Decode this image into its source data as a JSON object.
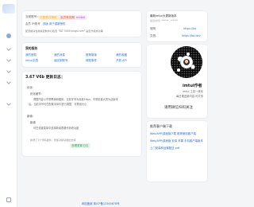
{
  "sidebar": {
    "icons": [
      "logo",
      "home-icon",
      "chevron-icon",
      "chevron-icon",
      "chevron-icon",
      "chevron-icon",
      "chevron-icon",
      "settings-icon"
    ]
  },
  "account": {
    "label": "当前账号：",
    "tag1": "已登录并授权",
    "tag2": "会员有效期",
    "tag3": "mhtbt",
    "line2_prefix": "会员 IP/账号",
    "line2_link1": "改版",
    "line2_link2": "用于重新授权",
    "line3": "配置前请在新版控制中心检查 \"BLT 5000 plugs.com\" 是否升级成功等"
  },
  "links_card": {
    "title": "我的服务",
    "col1": [
      "我的授权",
      "imtui文档"
    ],
    "col2": [
      "我的消息",
      "返回到账号"
    ],
    "col3": [
      "推荐新版",
      "转账事件"
    ],
    "col4": [
      "我的收藏",
      "开放 API"
    ]
  },
  "update": {
    "title": "3.67 V6b 更新日志：",
    "sec1_label": "优化：",
    "sec1_item": "优化细节：",
    "sec1_text_a": "调整内容以不带黑体和粗体，当前字号为标准16px，不带前最大的为此版本",
    "sec1_text_b": "后，当前字号可在配置字体中进行调整，可禁用大小",
    "sec2_label": "新增：",
    "sec2_item": "新增",
    "sec2_text": "可在设置菜单中选择新增表格代码块功能",
    "foot_text": "新增了1个代码插件，增加对新功能的支持",
    "foot_link": "查看更新日志"
  },
  "side_info": {
    "title": "最新imtui大更新版本",
    "subtitle": "最近访问: ******, ******",
    "row1_label": "官网",
    "row1_value": "https://bo",
    "row2_label": "文档",
    "row2_value": "https://bo.dev"
  },
  "qr_card": {
    "name": "imtui作者",
    "sub1": "imtui 工具一体化",
    "sub2": "每日推送新内容 可共享",
    "caption": "请用微信扫码关注"
  },
  "downloads": {
    "title": "推荐客户端下载",
    "items": [
      "Web/APP/桌面版下载 推荐使用客户端",
      "Web/APP/桌面版 安卓 苹果 手机客户端版本",
      "上门安装和运输配送 pdf"
    ]
  },
  "footer": {
    "text": "网站备案 粤ICP备12345678号"
  },
  "colors": {
    "accent": "#2e6fd8",
    "tag_orange": "#f5a623",
    "tag_red": "#e4573f",
    "tag_purple": "#9a59d6",
    "green": "#2a9d56"
  }
}
